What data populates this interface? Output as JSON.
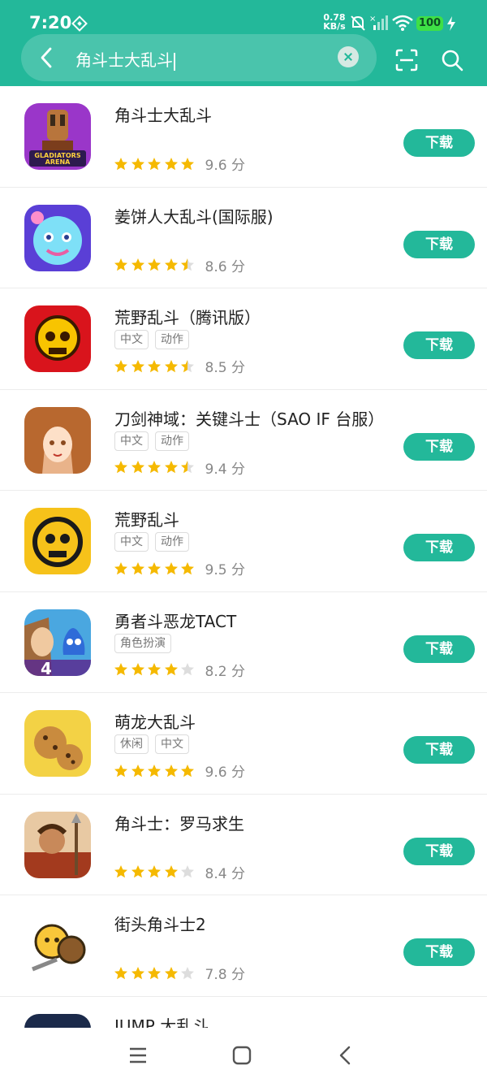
{
  "status": {
    "time": "7:20",
    "net_speed_value": "0.78",
    "net_speed_unit": "KB/s",
    "battery": "100"
  },
  "search": {
    "query": "角斗士大乱斗",
    "back_icon": "back-arrow-icon",
    "clear_icon": "clear-icon",
    "scan_icon": "scan-icon",
    "search_icon": "search-icon"
  },
  "colors": {
    "brand": "#23b89a",
    "star": "#f5b900",
    "star_empty": "#dddddd"
  },
  "results": [
    {
      "title": "角斗士大乱斗",
      "tags": [],
      "score": "9.6 分",
      "stars": 5,
      "button": "下载",
      "icon": "gladiators-arena-icon"
    },
    {
      "title": "姜饼人大乱斗(国际服)",
      "tags": [],
      "score": "8.6 分",
      "stars": 4.5,
      "button": "下载",
      "icon": "cookie-run-icon"
    },
    {
      "title": "荒野乱斗（腾讯版）",
      "tags": [
        "中文",
        "动作"
      ],
      "score": "8.5 分",
      "stars": 4.5,
      "button": "下载",
      "icon": "brawl-stars-red-icon"
    },
    {
      "title": "刀剑神域：关键斗士（SAO IF 台服）",
      "tags": [
        "中文",
        "动作"
      ],
      "score": "9.4 分",
      "stars": 4.5,
      "button": "下载",
      "icon": "sao-asuna-icon"
    },
    {
      "title": "荒野乱斗",
      "tags": [
        "中文",
        "动作"
      ],
      "score": "9.5 分",
      "stars": 5,
      "button": "下载",
      "icon": "brawl-stars-yellow-icon"
    },
    {
      "title": "勇者斗恶龙TACT",
      "tags": [
        "角色扮演"
      ],
      "score": "8.2 分",
      "stars": 4,
      "button": "下载",
      "icon": "dragon-quest-tact-icon"
    },
    {
      "title": "萌龙大乱斗",
      "tags": [
        "休闲",
        "中文"
      ],
      "score": "9.6 分",
      "stars": 5,
      "button": "下载",
      "icon": "cookie-dragon-icon"
    },
    {
      "title": "角斗士：罗马求生",
      "tags": [],
      "score": "8.4 分",
      "stars": 4,
      "button": "下载",
      "icon": "roman-gladiator-icon"
    },
    {
      "title": "街头角斗士2",
      "tags": [],
      "score": "7.8 分",
      "stars": 4,
      "button": "下载",
      "icon": "street-gladiator-icon"
    },
    {
      "title": "JUMP 大乱斗",
      "tags": [],
      "score": "",
      "stars": 0,
      "button": "",
      "icon": "jump-force-icon"
    }
  ],
  "nav": {
    "menu_icon": "menu-icon",
    "home_icon": "home-square-icon",
    "back_icon": "nav-back-icon"
  }
}
